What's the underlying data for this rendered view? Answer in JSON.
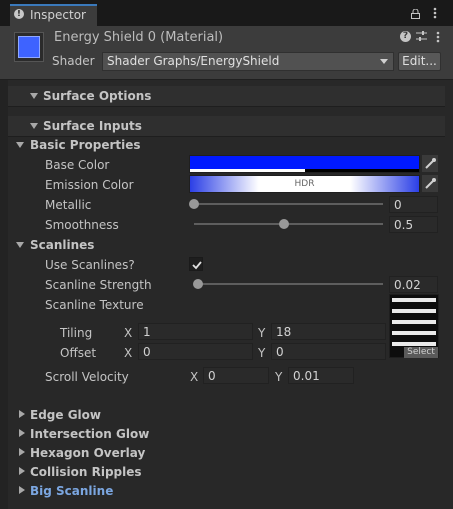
{
  "window": {
    "tab_title": "Inspector"
  },
  "header": {
    "material_name": "Energy Shield 0 (Material)",
    "shader_label": "Shader",
    "shader_value": "Shader Graphs/EnergyShield",
    "edit_button": "Edit..."
  },
  "sections": {
    "surface_options": "Surface Options",
    "surface_inputs": "Surface Inputs"
  },
  "basic": {
    "title": "Basic Properties",
    "base_color_label": "Base Color",
    "base_color": "#0019ff",
    "emission_label": "Emission Color",
    "emission_badge": "HDR",
    "emission_color": "#2b3fe6",
    "metallic_label": "Metallic",
    "metallic_value": "0",
    "metallic_fraction": 0,
    "smoothness_label": "Smoothness",
    "smoothness_value": "0.5",
    "smoothness_fraction": 0.5
  },
  "scanlines": {
    "title": "Scanlines",
    "use_label": "Use Scanlines?",
    "use_checked": true,
    "strength_label": "Scanline Strength",
    "strength_value": "0.02",
    "strength_fraction": 0.02,
    "texture_label": "Scanline Texture",
    "texture_select": "Select",
    "tiling_label": "Tiling",
    "tiling_x": "1",
    "tiling_y": "18",
    "offset_label": "Offset",
    "offset_x": "0",
    "offset_y": "0",
    "axis_x": "X",
    "axis_y": "Y",
    "scroll_label": "Scroll Velocity",
    "scroll_x": "0",
    "scroll_y": "0.01"
  },
  "collapsed_groups": [
    "Edge Glow",
    "Intersection Glow",
    "Hexagon Overlay",
    "Collision Ripples",
    "Big Scanline"
  ]
}
